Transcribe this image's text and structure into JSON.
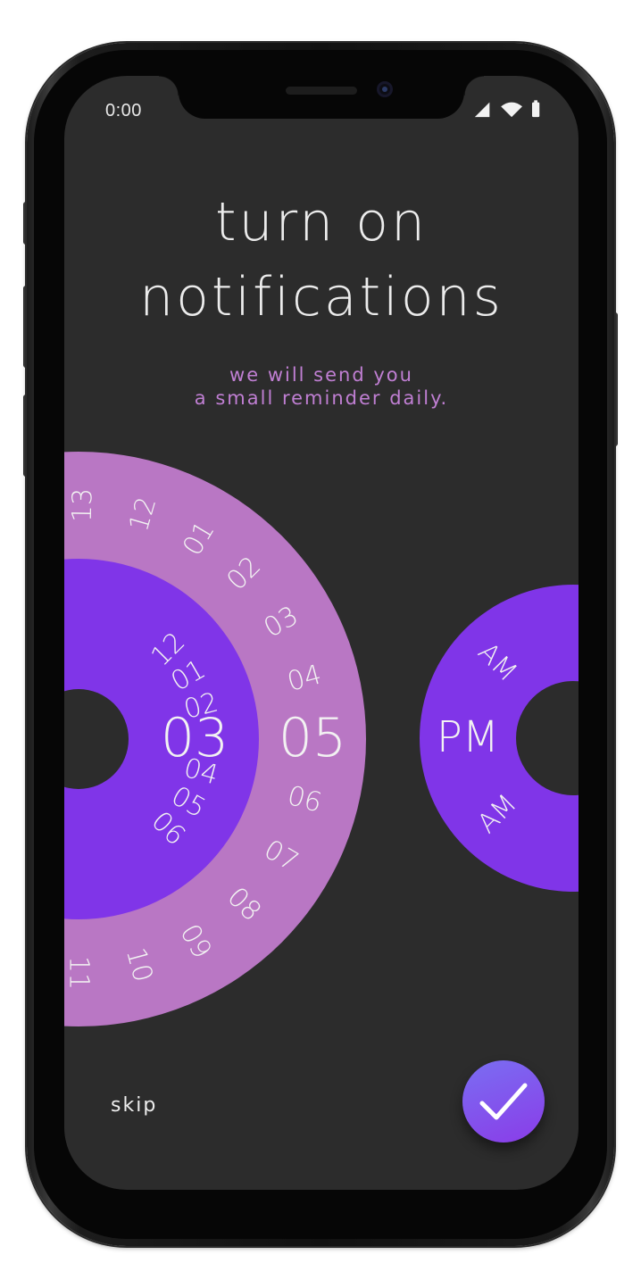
{
  "status_bar": {
    "time": "0:00"
  },
  "title_line1": "turn on",
  "title_line2": "notifications",
  "subtitle_line1": "we will send you",
  "subtitle_line2": "a small reminder daily.",
  "hour_wheel": {
    "selected": "03",
    "labels": [
      "12",
      "01",
      "02",
      "04",
      "05",
      "06"
    ],
    "color": "#8035e8"
  },
  "minute_wheel": {
    "selected": "05",
    "labels": [
      "13",
      "12",
      "01",
      "02",
      "03",
      "04",
      "06",
      "07",
      "08",
      "09",
      "10",
      "11"
    ],
    "color": "#b977c4"
  },
  "ampm_wheel": {
    "selected": "PM",
    "labels": [
      "AM",
      "AM"
    ],
    "color": "#8035e8"
  },
  "skip_label": "skip",
  "icons": {
    "confirm": "checkmark-icon",
    "signal": "signal-icon",
    "wifi": "wifi-icon",
    "battery": "battery-icon"
  },
  "colors": {
    "background": "#2c2c2c",
    "accent": "#8035e8",
    "secondary": "#b977c4",
    "subtitle": "#c07fd3"
  }
}
